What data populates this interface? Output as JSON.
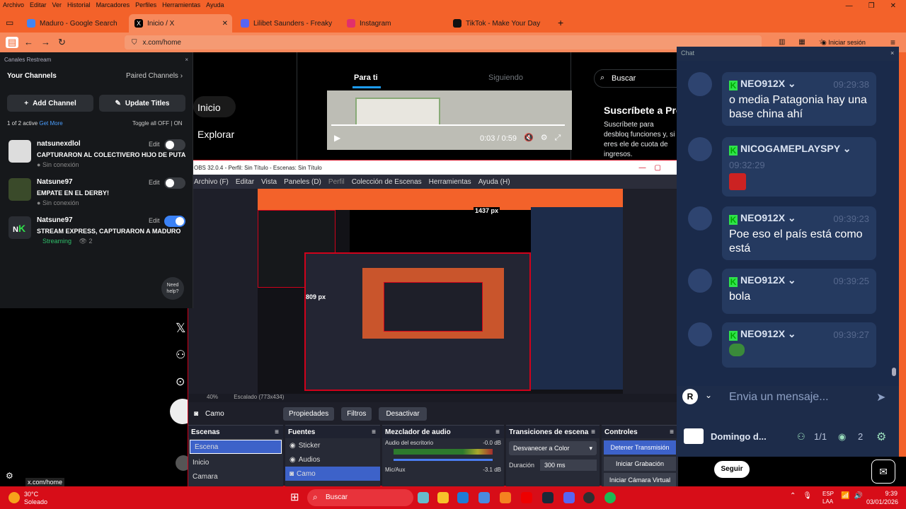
{
  "browser": {
    "menu": [
      "Archivo",
      "Editar",
      "Ver",
      "Historial",
      "Marcadores",
      "Perfiles",
      "Herramientas",
      "Ayuda"
    ],
    "tabs": [
      {
        "label": "Maduro - Google Search",
        "color": "#4285f4"
      },
      {
        "label": "Inicio / X",
        "color": "#000000"
      },
      {
        "label": "Lilibet Saunders - Freaky Baddi",
        "color": "#5865f2"
      },
      {
        "label": "Instagram",
        "color": "#e1306c"
      },
      {
        "label": "TikTok - Make Your Day",
        "color": "#111111"
      }
    ],
    "url": "x.com/home",
    "signin": "Iniciar sesión",
    "status_url": "x.com/home"
  },
  "restream": {
    "window_title": "Canales Restream",
    "your_channels": "Your Channels",
    "paired_channels": "Paired Channels",
    "add_channel": "Add Channel",
    "update_titles": "Update Titles",
    "active_count": "1 of 2 active",
    "get_more": "Get More",
    "toggle_all": "Toggle all OFF",
    "on_label": "ON",
    "edit_label": "Edit",
    "need_help": "Need help?",
    "channels": [
      {
        "name": "natsunexdlol",
        "title": "CAPTURARON AL COLECTIVERO HIJO DE PUTA",
        "status": "Sin conexión",
        "on": false
      },
      {
        "name": "Natsune97",
        "title": "EMPATE EN EL DERBY!",
        "status": "Sin conexión",
        "on": false
      },
      {
        "name": "Natsune97",
        "title": "STREAM EXPRESS, CAPTURARON A MADURO",
        "status": "Streaming",
        "viewers": "2",
        "on": true
      }
    ]
  },
  "x": {
    "nav_home": "Inicio",
    "nav_explore": "Explorar",
    "tab_for_you": "Para ti",
    "tab_following": "Siguiendo",
    "search_placeholder": "Buscar",
    "premium_title": "Suscríbete a Pre",
    "premium_text": "Suscríbete para desbloq funciones y, si eres ele de cuota de ingresos.",
    "video_time": "0:03 / 0:59",
    "follow": "Seguir"
  },
  "obs": {
    "title": "OBS 32.0.4 - Perfil: Sin Título - Escenas: Sin Título",
    "menu": [
      "Archivo (F)",
      "Editar",
      "Vista",
      "Paneles (D)",
      "Perfil",
      "Colección de Escenas",
      "Herramientas",
      "Ayuda (H)"
    ],
    "zoom": "40%",
    "scaled": "Escalado (773x434)",
    "width_px": "1437 px",
    "height_px": "809 px",
    "source_name": "Camo",
    "properties": "Propiedades",
    "filters": "Filtros",
    "deactivate": "Desactivar",
    "scenes_title": "Escenas",
    "scenes": [
      "Escena",
      "Inicio",
      "Camara"
    ],
    "sources_title": "Fuentes",
    "sources": [
      "Sticker",
      "Audios",
      "Camo"
    ],
    "mixer_title": "Mezclador de audio",
    "mixer_desktop": "Audio del escritorio",
    "mixer_desktop_db": "-0.0 dB",
    "mixer_mic": "Mic/Aux",
    "mixer_mic_db": "-3.1 dB",
    "transitions_title": "Transiciones de escena",
    "transition_type": "Desvanecer a Color",
    "duration_label": "Duración",
    "duration_value": "300 ms",
    "controls_title": "Controles",
    "stop_stream": "Detener Transmisión",
    "start_record": "Iniciar Grabación",
    "start_vcam": "Iniciar Cámara Virtual"
  },
  "chat": {
    "title": "Chat",
    "messages": [
      {
        "user": "NEO912X",
        "time": "09:29:38",
        "text": "o media Patagonia hay una base china ahí"
      },
      {
        "user": "NICOGAMEPLAYSPY",
        "time": "09:32:29",
        "text": ""
      },
      {
        "user": "NEO912X",
        "time": "09:39:23",
        "text": "Poe eso el país está como está"
      },
      {
        "user": "NEO912X",
        "time": "09:39:25",
        "text": "bola"
      },
      {
        "user": "NEO912X",
        "time": "09:39:27",
        "text": ""
      }
    ],
    "input_placeholder": "Envia un mensaje...",
    "footer_name": "Domingo d...",
    "footer_count": "1/1",
    "footer_viewers": "2"
  },
  "taskbar": {
    "temp": "30°C",
    "weather": "Soleado",
    "search": "Buscar",
    "lang": "ESP",
    "lang2": "LAA",
    "time": "9:39",
    "date": "03/01/2026"
  }
}
